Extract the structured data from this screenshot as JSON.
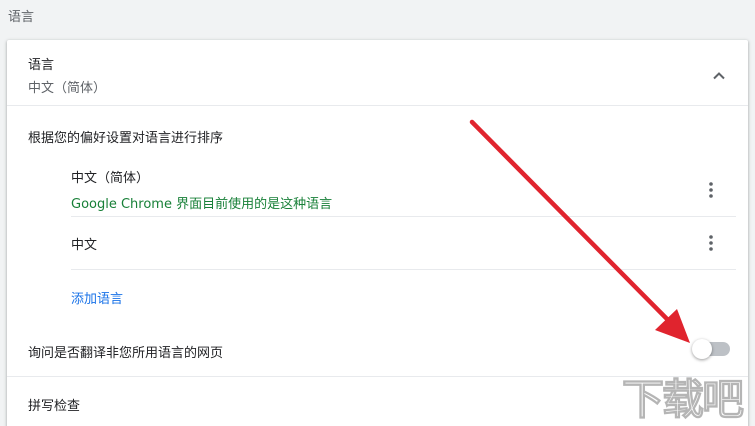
{
  "section": {
    "title": "语言"
  },
  "languages_panel": {
    "title": "语言",
    "current": "中文（简体）",
    "sort_label": "根据您的偏好设置对语言进行排序",
    "items": [
      {
        "name": "中文（简体）",
        "note": "Google Chrome 界面目前使用的是这种语言"
      },
      {
        "name": "中文",
        "note": ""
      }
    ],
    "add_language": "添加语言"
  },
  "translate": {
    "label": "询问是否翻译非您所用语言的网页",
    "enabled": false
  },
  "spellcheck": {
    "label": "拼写检查"
  },
  "watermark": {
    "text": "下载吧"
  },
  "colors": {
    "accent": "#1a73e8",
    "note_green": "#188038",
    "arrow_red": "#e0242e",
    "toggle_off": "#bdc1c6"
  },
  "icons": {
    "collapse": "chevron-up-icon",
    "more": "more-vert-icon"
  }
}
